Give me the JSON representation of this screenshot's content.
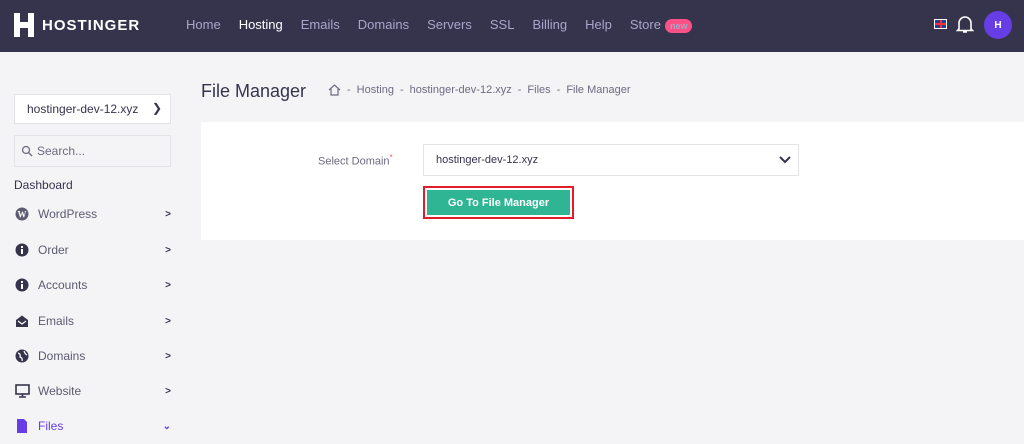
{
  "header": {
    "brand": "HOSTINGER",
    "nav": [
      "Home",
      "Hosting",
      "Emails",
      "Domains",
      "Servers",
      "SSL",
      "Billing",
      "Help",
      "Store"
    ],
    "active": "Hosting",
    "store_badge": "new",
    "avatar_text": "H"
  },
  "sidebar": {
    "domain": "hostinger-dev-12.xyz",
    "search_placeholder": "Search...",
    "heading": "Dashboard",
    "items": [
      {
        "label": "WordPress"
      },
      {
        "label": "Order"
      },
      {
        "label": "Accounts"
      },
      {
        "label": "Emails"
      },
      {
        "label": "Domains"
      },
      {
        "label": "Website"
      },
      {
        "label": "Files"
      }
    ]
  },
  "page": {
    "title": "File Manager",
    "breadcrumb": [
      "Hosting",
      "hostinger-dev-12.xyz",
      "Files",
      "File Manager"
    ],
    "separator": "-"
  },
  "form": {
    "label": "Select Domain",
    "required": "*",
    "domain": "hostinger-dev-12.xyz",
    "button": "Go To File Manager"
  },
  "colors": {
    "header": "#36344d",
    "accent": "#673de6",
    "button": "#30b594",
    "highlight": "#e11d2b"
  }
}
